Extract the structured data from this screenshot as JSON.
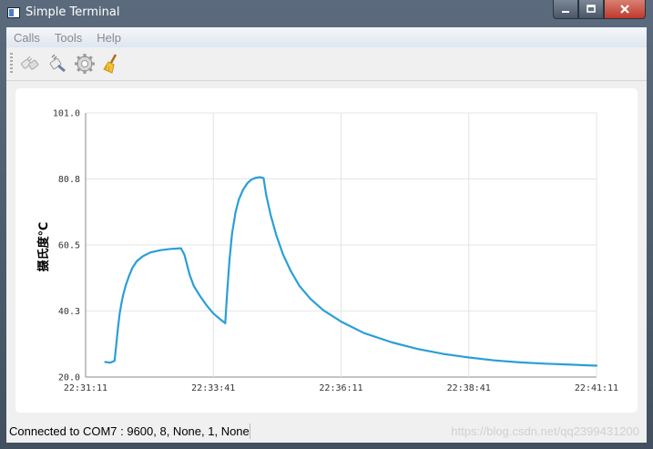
{
  "window": {
    "title": "Simple Terminal"
  },
  "menubar": {
    "items": [
      "Calls",
      "Tools",
      "Help"
    ]
  },
  "toolbar": {
    "icons": [
      "connect-icon",
      "disconnect-icon",
      "settings-gear-icon",
      "clear-broom-icon"
    ]
  },
  "status": {
    "text": "Connected to COM7 : 9600, 8, None, 1, None",
    "watermark": "https://blog.csdn.net/qq2399431200"
  },
  "colors": {
    "line": "#2a9fd6",
    "grid": "#e4e4e4",
    "axis": "#8a8a8a"
  },
  "chart_data": {
    "type": "line",
    "ylabel": "摄氏度℃",
    "xlabel": "",
    "y_ticks": [
      "101.0",
      "80.8",
      "60.5",
      "40.3",
      "20.0"
    ],
    "ylim": [
      20.0,
      101.0
    ],
    "x_ticks": [
      "22:31:11",
      "22:33:41",
      "22:36:11",
      "22:38:41",
      "22:41:11"
    ],
    "xlim": [
      "22:31:11",
      "22:41:11"
    ],
    "grid": true,
    "legend": "none",
    "series": [
      {
        "x": [
          "22:31:34",
          "22:31:40",
          "22:31:45",
          "22:31:47",
          "22:31:49",
          "22:31:51",
          "22:31:53",
          "22:31:55",
          "22:31:58",
          "22:32:02",
          "22:32:06",
          "22:32:11",
          "22:32:18",
          "22:32:27",
          "22:32:39",
          "22:32:51",
          "22:33:03",
          "22:33:07",
          "22:33:10",
          "22:33:13",
          "22:33:18",
          "22:33:25",
          "22:33:33",
          "22:33:41",
          "22:33:50",
          "22:33:55",
          "22:33:57",
          "22:34:00",
          "22:34:03",
          "22:34:07",
          "22:34:11",
          "22:34:16",
          "22:34:21",
          "22:34:26",
          "22:34:31",
          "22:34:36",
          "22:34:40",
          "22:34:43",
          "22:34:48",
          "22:34:55",
          "22:35:03",
          "22:35:12",
          "22:35:22",
          "22:35:35",
          "22:35:50",
          "22:36:11",
          "22:36:38",
          "22:37:11",
          "22:37:41",
          "22:38:11",
          "22:38:41",
          "22:39:11",
          "22:39:41",
          "22:40:11",
          "22:40:41",
          "22:41:11"
        ],
        "y": [
          24.6,
          24.4,
          25.0,
          30.0,
          35.0,
          39.5,
          42.5,
          45.0,
          48.0,
          51.0,
          53.5,
          55.5,
          57.0,
          58.2,
          58.9,
          59.3,
          59.5,
          57.5,
          54.5,
          51.5,
          48.0,
          45.0,
          42.0,
          39.5,
          37.5,
          36.5,
          45.0,
          56.0,
          64.0,
          70.5,
          74.5,
          77.5,
          79.5,
          80.6,
          81.1,
          81.3,
          81.0,
          76.0,
          70.0,
          63.5,
          57.5,
          52.5,
          48.0,
          44.0,
          40.5,
          37.0,
          33.5,
          30.6,
          28.6,
          27.1,
          26.0,
          25.1,
          24.5,
          24.1,
          23.8,
          23.5
        ]
      }
    ]
  }
}
